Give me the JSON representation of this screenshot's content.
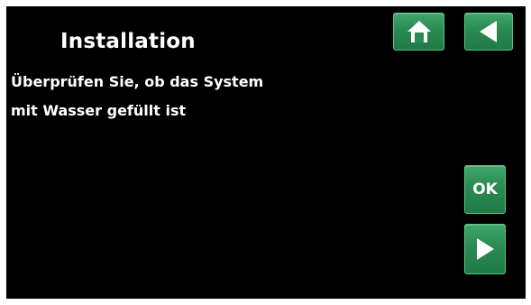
{
  "header": {
    "title": "Installation"
  },
  "main": {
    "message_line1": "Überprüfen Sie, ob das System",
    "message_line2": "mit Wasser gefüllt ist"
  },
  "buttons": {
    "home_icon": "home-icon",
    "back_icon": "arrow-left-icon",
    "ok_label": "OK",
    "next_icon": "arrow-right-icon"
  },
  "colors": {
    "background": "#000000",
    "button_green": "#2a8a52",
    "text": "#ffffff"
  }
}
